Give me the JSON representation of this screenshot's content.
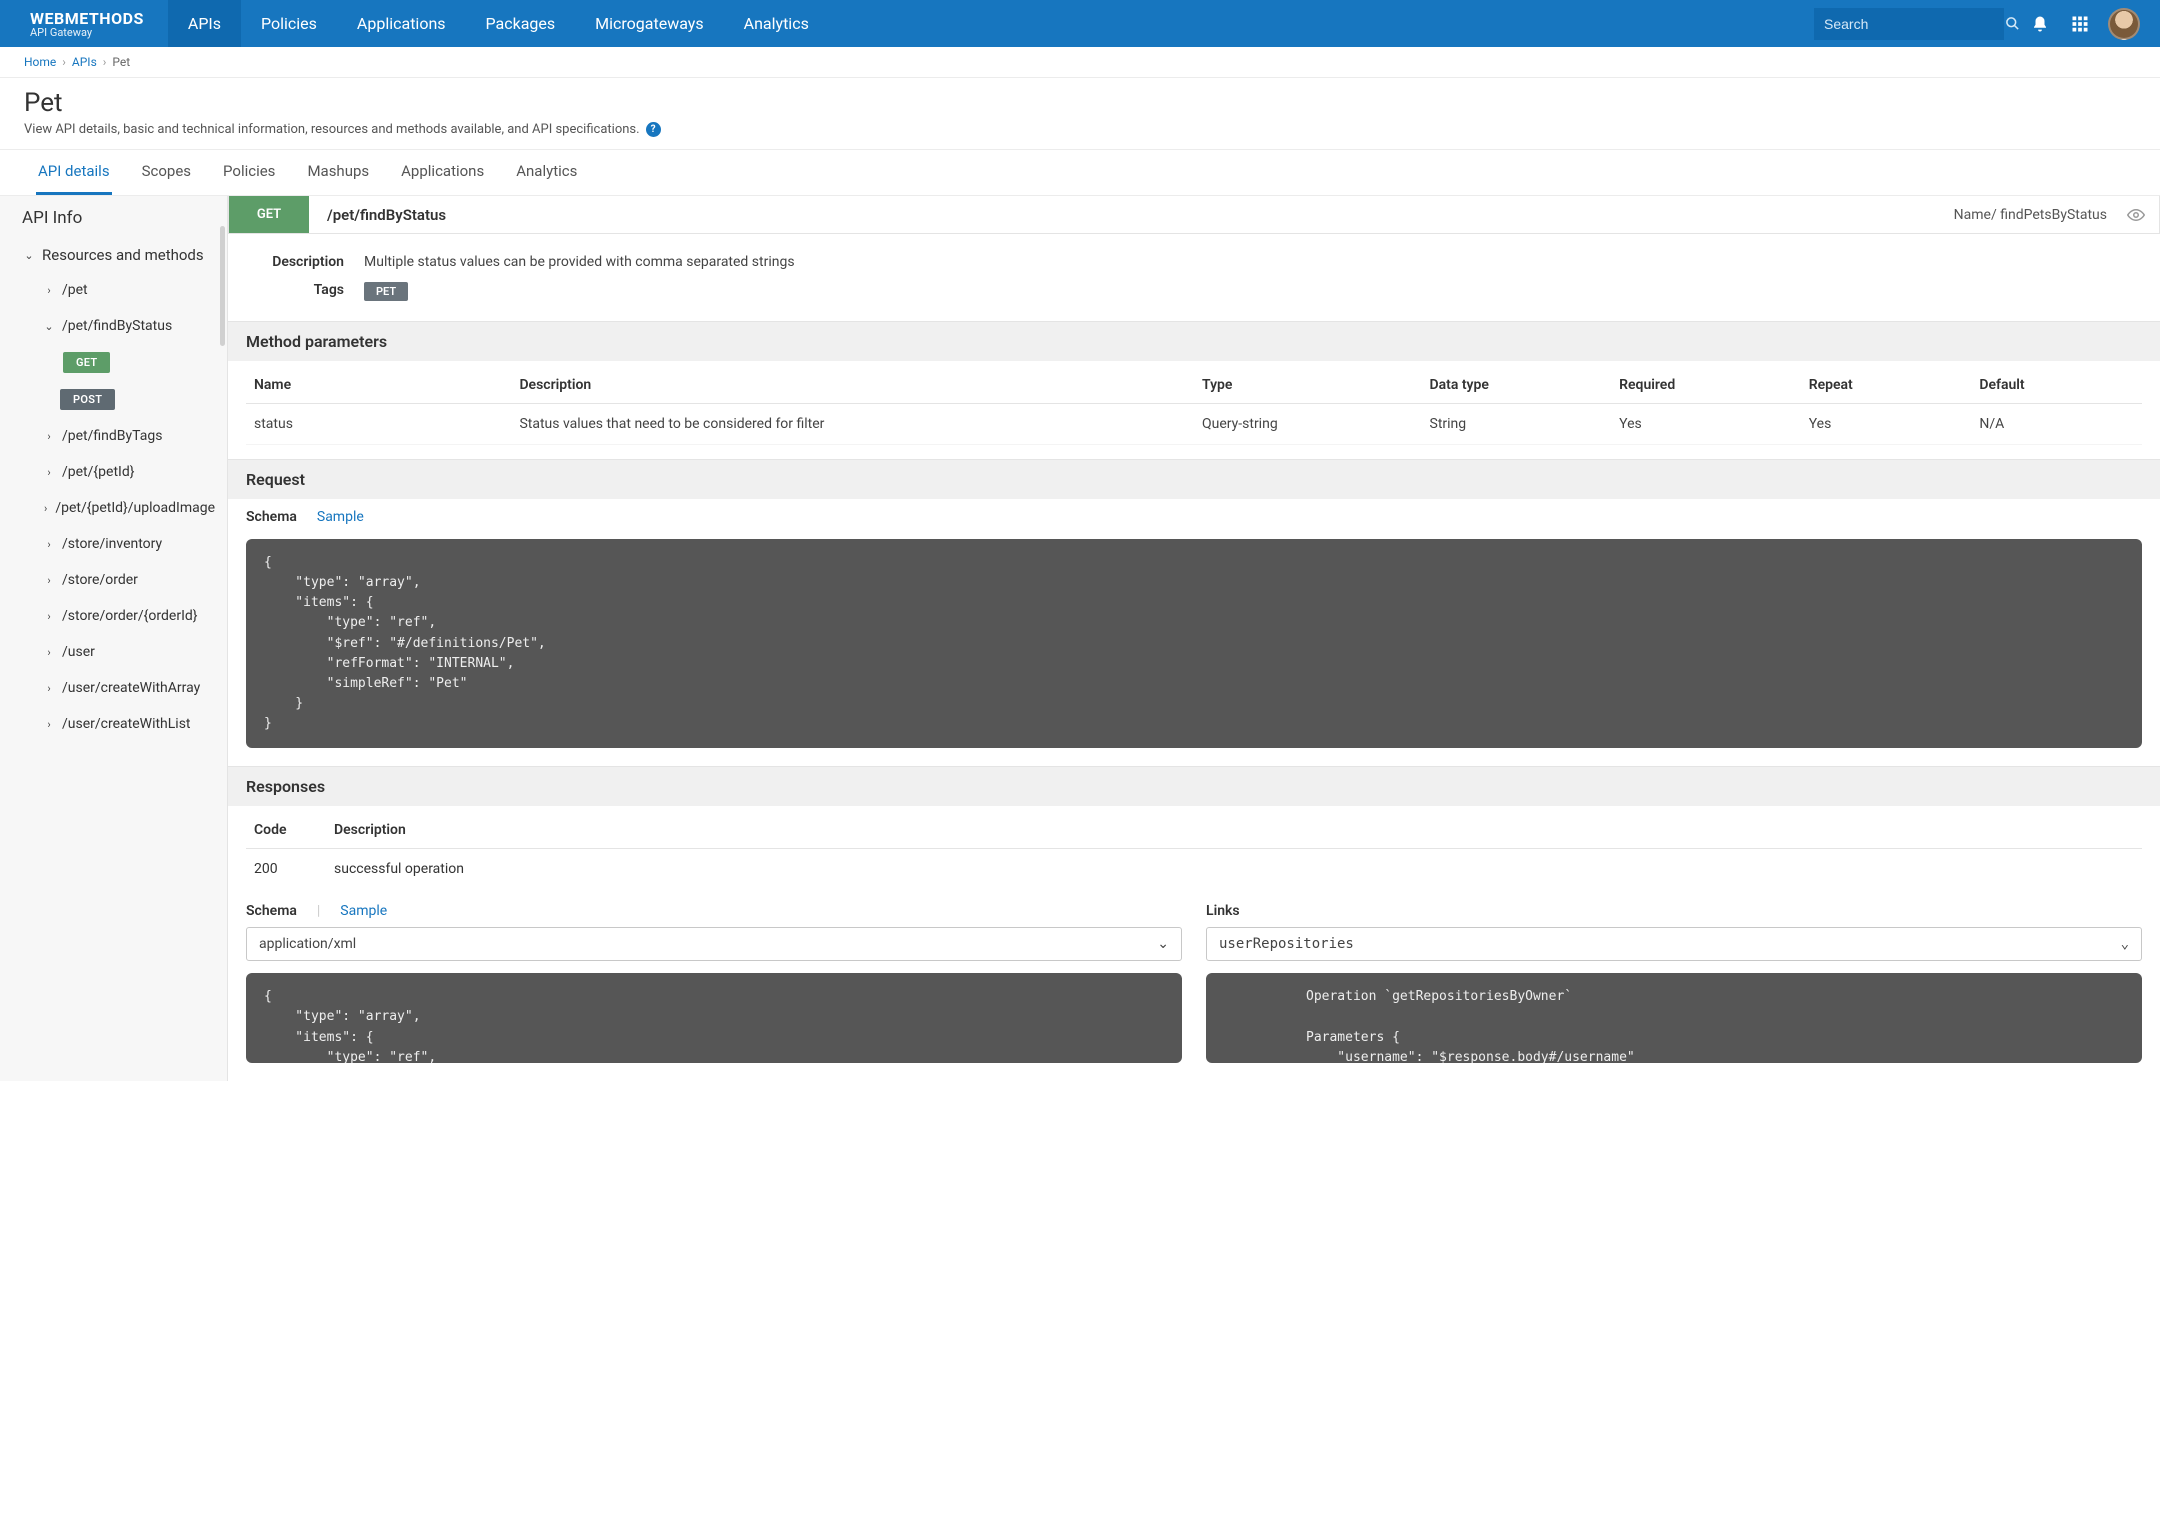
{
  "brand": {
    "primary": "WEBMETHODS",
    "secondary": "API Gateway"
  },
  "topnav": {
    "items": [
      "APIs",
      "Policies",
      "Applications",
      "Packages",
      "Microgateways",
      "Analytics"
    ],
    "active_index": 0
  },
  "search": {
    "placeholder": "Search"
  },
  "breadcrumb": {
    "items": [
      "Home",
      "APIs",
      "Pet"
    ]
  },
  "page": {
    "title": "Pet",
    "subtitle": "View API details, basic and technical information, resources and methods available, and API specifications."
  },
  "tabs": {
    "items": [
      "API details",
      "Scopes",
      "Policies",
      "Mashups",
      "Applications",
      "Analytics"
    ],
    "active_index": 0
  },
  "sidebar": {
    "info_label": "API Info",
    "group_label": "Resources and methods",
    "resources": [
      {
        "path": "/pet",
        "expanded": false
      },
      {
        "path": "/pet/findByStatus",
        "expanded": true,
        "methods": [
          {
            "verb": "GET",
            "active": true
          },
          {
            "verb": "POST",
            "active": false
          }
        ]
      },
      {
        "path": "/pet/findByTags",
        "expanded": false
      },
      {
        "path": "/pet/{petId}",
        "expanded": false
      },
      {
        "path": "/pet/{petId}/uploadImage",
        "expanded": false
      },
      {
        "path": "/store/inventory",
        "expanded": false
      },
      {
        "path": "/store/order",
        "expanded": false
      },
      {
        "path": "/store/order/{orderId}",
        "expanded": false
      },
      {
        "path": "/user",
        "expanded": false
      },
      {
        "path": "/user/createWithArray",
        "expanded": false
      },
      {
        "path": "/user/createWithList",
        "expanded": false
      }
    ]
  },
  "method": {
    "verb": "GET",
    "path": "/pet/findByStatus",
    "name_label": "Name/",
    "operation_name": "findPetsByStatus",
    "description_label": "Description",
    "description": "Multiple status values can be provided with comma separated strings",
    "tags_label": "Tags",
    "tags": [
      "PET"
    ]
  },
  "params": {
    "title": "Method parameters",
    "columns": [
      "Name",
      "Description",
      "Type",
      "Data type",
      "Required",
      "Repeat",
      "Default"
    ],
    "rows": [
      {
        "name": "status",
        "description": "Status values that need to be considered for filter",
        "type": "Query-string",
        "data_type": "String",
        "required": "Yes",
        "repeat": "Yes",
        "default": "N/A"
      }
    ]
  },
  "request": {
    "title": "Request",
    "subtabs": {
      "schema": "Schema",
      "sample": "Sample"
    },
    "code": "{\n    \"type\": \"array\",\n    \"items\": {\n        \"type\": \"ref\",\n        \"$ref\": \"#/definitions/Pet\",\n        \"refFormat\": \"INTERNAL\",\n        \"simpleRef\": \"Pet\"\n    }\n}"
  },
  "responses": {
    "title": "Responses",
    "columns": [
      "Code",
      "Description"
    ],
    "rows": [
      {
        "code": "200",
        "description": "successful operation"
      }
    ],
    "schema_label": "Schema",
    "sample_label": "Sample",
    "links_label": "Links",
    "schema_select": "application/xml",
    "links_select": "userRepositories",
    "schema_code": "{\n    \"type\": \"array\",\n    \"items\": {\n        \"type\": \"ref\",",
    "links_code": "Operation `getRepositoriesByOwner`\n\nParameters {\n    \"username\": \"$response.body#/username\""
  }
}
